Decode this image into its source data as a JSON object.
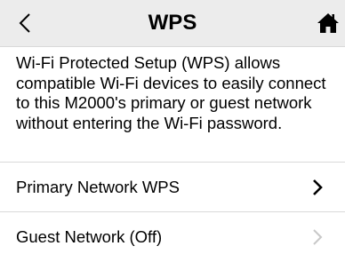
{
  "header": {
    "title": "WPS",
    "back_icon": "chevron-left-icon",
    "home_icon": "home-icon"
  },
  "description": "Wi-Fi Protected Setup (WPS) allows compatible Wi-Fi devices to easily connect to this M2000's primary or guest network without entering the Wi-Fi password.",
  "rows": [
    {
      "label": "Primary Network WPS",
      "enabled": true,
      "icon": "chevron-right-icon"
    },
    {
      "label": "Guest Network (Off)",
      "enabled": false,
      "icon": "chevron-right-icon"
    }
  ],
  "colors": {
    "header_bg": "#ececec",
    "divider": "#d9d9d9",
    "text": "#000000",
    "disabled_chevron": "#c8c8c8"
  }
}
